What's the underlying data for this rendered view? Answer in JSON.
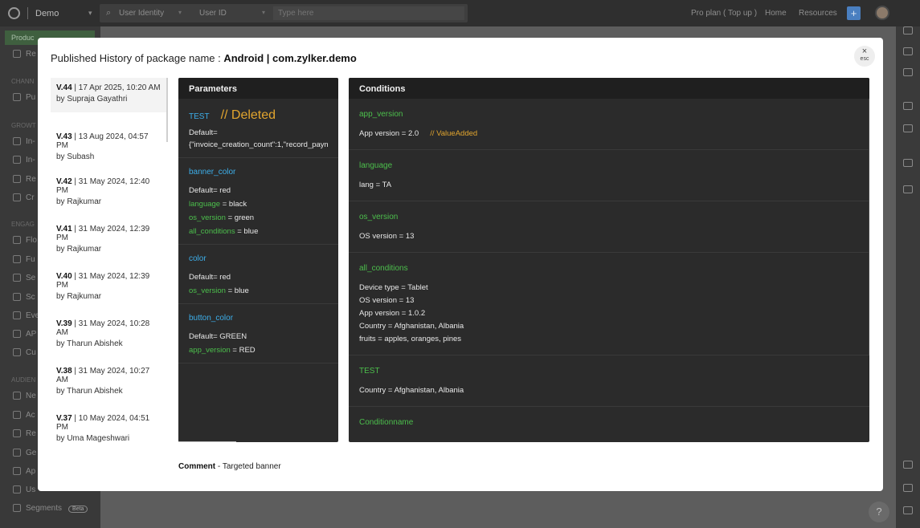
{
  "topbar": {
    "brand": "Demo",
    "search_category": "User Identity",
    "search_field": "User ID",
    "search_placeholder": "Type here",
    "plan_text": "Pro plan ( Top up )",
    "nav_home": "Home",
    "nav_resources": "Resources"
  },
  "sidebar": {
    "top_item": "Produc",
    "labels": [
      "CHANN",
      "GROWT",
      "ENGAG",
      "AUDIEN"
    ],
    "items": [
      "Re",
      "Pu",
      "In-",
      "In-",
      "Re",
      "Cr",
      "Flo",
      "Fu",
      "Se",
      "Sc",
      "Eve",
      "AP",
      "Cu",
      "Ne",
      "Ac",
      "Re",
      "Ge",
      "Ap",
      "Us"
    ],
    "segments": "Segments",
    "segments_badge": "Beta"
  },
  "modal": {
    "title_prefix": "Published History of package name : ",
    "title_package": "Android | com.zylker.demo",
    "close_label": "esc",
    "close_icon": "×",
    "versions": [
      {
        "version": "V.44",
        "date": " | 17 Apr 2025, 10:20 AM",
        "author": "by Supraja Gayathri"
      },
      {
        "version": "V.43",
        "date": " | 13 Aug 2024, 04:57 PM",
        "author": "by Subash"
      },
      {
        "version": "V.42",
        "date": " | 31 May 2024, 12:40 PM",
        "author": "by Rajkumar"
      },
      {
        "version": "V.41",
        "date": " | 31 May 2024, 12:39 PM",
        "author": "by Rajkumar"
      },
      {
        "version": "V.40",
        "date": " | 31 May 2024, 12:39 PM",
        "author": "by Rajkumar"
      },
      {
        "version": "V.39",
        "date": " | 31 May 2024, 10:28 AM",
        "author": "by Tharun Abishek"
      },
      {
        "version": "V.38",
        "date": " | 31 May 2024, 10:27 AM",
        "author": "by Tharun Abishek"
      },
      {
        "version": "V.37",
        "date": " | 10 May 2024, 04:51 PM",
        "author": "by Uma Mageshwari"
      }
    ],
    "parameters": {
      "header": "Parameters",
      "blocks": [
        {
          "name": "TEST",
          "tag": "// Deleted",
          "lines": [
            [
              "",
              "Default="
            ],
            [
              "",
              "{\"invoice_creation_count\":1,\"record_payment\""
            ]
          ]
        },
        {
          "name": "banner_color",
          "lines": [
            [
              "",
              "Default= red"
            ],
            [
              "language",
              " = black"
            ],
            [
              "os_version",
              " = green"
            ],
            [
              "all_conditions",
              " = blue"
            ]
          ]
        },
        {
          "name": "color",
          "lines": [
            [
              "",
              "Default= red"
            ],
            [
              "os_version",
              " = blue"
            ]
          ]
        },
        {
          "name": "button_color",
          "lines": [
            [
              "",
              "Default= GREEN"
            ],
            [
              "app_version",
              " = RED"
            ]
          ]
        }
      ]
    },
    "conditions": {
      "header": "Conditions",
      "blocks": [
        {
          "name": "app_version",
          "lines": [
            "App version = 2.0"
          ],
          "tag": "// ValueAdded"
        },
        {
          "name": "language",
          "lines": [
            "lang = TA"
          ]
        },
        {
          "name": "os_version",
          "lines": [
            "OS version = 13"
          ]
        },
        {
          "name": "all_conditions",
          "lines": [
            "Device type = Tablet",
            "OS version = 13",
            "App version = 1.0.2",
            "Country = Afghanistan, Albania",
            "fruits = apples, oranges, pines"
          ]
        },
        {
          "name": "TEST",
          "lines": [
            "Country = Afghanistan, Albania"
          ]
        },
        {
          "name": "Conditionname",
          "lines": []
        }
      ]
    },
    "comment_label": "Comment",
    "comment_text": " - Targeted banner"
  }
}
